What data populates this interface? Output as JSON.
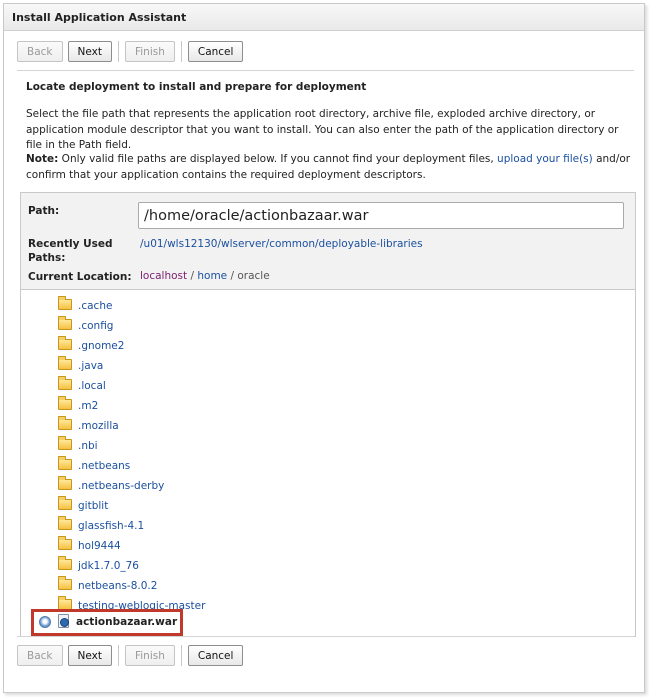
{
  "window": {
    "title": "Install Application Assistant"
  },
  "buttons": {
    "back": "Back",
    "next": "Next",
    "finish": "Finish",
    "cancel": "Cancel"
  },
  "content": {
    "heading": "Locate deployment to install and prepare for deployment",
    "description": "Select the file path that represents the application root directory, archive file, exploded archive directory, or application module descriptor that you want to install. You can also enter the path of the application directory or file in the Path field.",
    "note_label": "Note:",
    "note_before_link": " Only valid file paths are displayed below. If you cannot find your deployment files, ",
    "note_link": "upload your file(s)",
    "note_after_link": " and/or confirm that your application contains the required deployment descriptors."
  },
  "form": {
    "path_label": "Path:",
    "path_value": "/home/oracle/actionbazaar.war",
    "recent_label": "Recently Used Paths:",
    "recent_path": "/u01/wls12130/wlserver/common/deployable-libraries",
    "location_label": "Current Location:",
    "breadcrumb": [
      "localhost",
      "home",
      "oracle"
    ],
    "breadcrumb_sep": " / "
  },
  "folders": [
    ".cache",
    ".config",
    ".gnome2",
    ".java",
    ".local",
    ".m2",
    ".mozilla",
    ".nbi",
    ".netbeans",
    ".netbeans-derby",
    "gitblit",
    "glassfish-4.1",
    "hol9444",
    "jdk1.7.0_76",
    "netbeans-8.0.2",
    "testing-weblogic-master"
  ],
  "selected_file": {
    "name": "actionbazaar.war",
    "selected": true
  }
}
